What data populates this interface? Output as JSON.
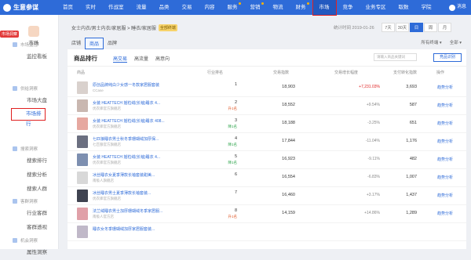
{
  "topbar": {
    "logo": "生意参谋",
    "nav": [
      "首页",
      "实时",
      "作战室",
      "流量",
      "品类",
      "交易",
      "内容",
      "服务",
      "营销",
      "物流",
      "财务",
      "市场",
      "竞争",
      "业务专区",
      "取数",
      "学院"
    ],
    "active_nav": "市场",
    "user": "消息"
  },
  "sidebar": {
    "badge": "市场洞察",
    "head_label": "市场",
    "groups": [
      {
        "title": "市场监控",
        "items": [
          "监控看板"
        ]
      },
      {
        "title": "供给洞察",
        "items": [
          "市场大盘",
          "市场排行"
        ]
      },
      {
        "title": "搜索洞察",
        "items": [
          "搜索排行",
          "搜索分析",
          "搜索人群"
        ]
      },
      {
        "title": "客群洞察",
        "items": [
          "行业客群",
          "客群透视"
        ]
      },
      {
        "title": "机会洞察",
        "items": [
          "属性洞察"
        ]
      }
    ],
    "active_item": "市场排行"
  },
  "toolbar": {
    "shop_path": "女士内衣/男士内衣/家居服 > 睡衣/家居服",
    "shop_badge": "全部终端",
    "date": "统计时间 2019-01-26",
    "ranges": [
      "7天",
      "30天",
      "日",
      "周",
      "月"
    ],
    "active_range": "日",
    "category_tabs": [
      "店铺",
      "商品",
      "品牌"
    ],
    "active_category": "商品",
    "filters": [
      "所有终端",
      "全部"
    ]
  },
  "panel": {
    "title": "商品排行",
    "sub_tabs": [
      "高交易",
      "高流量",
      "高意向"
    ],
    "active_sub_tab": "高交易",
    "search_placeholder": "请输入商品关键词",
    "compare_label": "竞品识别",
    "columns": [
      "商品",
      "行业排名",
      "交易指数",
      "交易增长幅度",
      "支付转化指数",
      "操作"
    ],
    "rows": [
      {
        "name": "原创品牌纯白少女感一冬款家居服套装",
        "shop": "CCase",
        "rank": "1",
        "change": "",
        "change_dir": "none",
        "index": "18,903",
        "growth": "+7,231.03%",
        "growth_dir": "up",
        "conversion": "3,693",
        "action": "趋势分析",
        "thumb": "#d9d1cd"
      },
      {
        "name": "女装 HEATTECH 摇粒绒(长袖)睡衣 4...",
        "shop": "优衣库官方旗舰店",
        "rank": "2",
        "change": "升1名",
        "change_dir": "up",
        "index": "18,552",
        "growth": "+9.54%",
        "growth_dir": "down",
        "conversion": "587",
        "action": "趋势分析",
        "thumb": "#c9b7b0"
      },
      {
        "name": "女装 HEATTECH 摇粒绒(长袖)睡衣 408...",
        "shop": "优衣库官方旗舰店",
        "rank": "3",
        "change": "降1名",
        "change_dir": "down",
        "index": "18,188",
        "growth": "-3.25%",
        "growth_dir": "down",
        "conversion": "651",
        "action": "趋势分析",
        "thumb": "#e6a8a0"
      },
      {
        "name": "七匹狼睡衣男士秋冬季珊瑚绒加厚保...",
        "shop": "七匹狼官方旗舰店",
        "rank": "4",
        "change": "降1名",
        "change_dir": "down",
        "index": "17,844",
        "growth": "-11.04%",
        "growth_dir": "down",
        "conversion": "1,176",
        "action": "趋势分析",
        "thumb": "#6b6f80"
      },
      {
        "name": "女装 HEATTECH 摇粒绒(长袖)睡衣 4...",
        "shop": "优衣库官方旗舰店",
        "rank": "5",
        "change": "降1名",
        "change_dir": "down",
        "index": "16,923",
        "growth": "-9.11%",
        "growth_dir": "down",
        "conversion": "482",
        "action": "趋势分析",
        "thumb": "#7d8fb0"
      },
      {
        "name": "冰丝睡衣女夏季薄款长袖套装甜美...",
        "shop": "南极人旗舰店",
        "rank": "6",
        "change": "",
        "change_dir": "none",
        "index": "16,554",
        "growth": "-6.83%",
        "growth_dir": "down",
        "conversion": "1,007",
        "action": "趋势分析",
        "thumb": "#d8d8d8"
      },
      {
        "name": "冰丝睡衣男士夏季薄款长袖套装...",
        "shop": "优衣库官方旗舰店",
        "rank": "7",
        "change": "",
        "change_dir": "none",
        "index": "16,460",
        "growth": "+3.17%",
        "growth_dir": "down",
        "conversion": "1,437",
        "action": "趋势分析",
        "thumb": "#3f4350"
      },
      {
        "name": "法兰绒睡衣男士加厚珊瑚绒冬季家居服...",
        "shop": "南极人官方店",
        "rank": "8",
        "change": "升1名",
        "change_dir": "up",
        "index": "14,159",
        "growth": "+14.86%",
        "growth_dir": "down",
        "conversion": "1,289",
        "action": "趋势分析",
        "thumb": "#e0a0a8"
      },
      {
        "name": "睡衣女冬季珊瑚绒加厚家居服套装...",
        "shop": "",
        "rank": "",
        "change": "",
        "change_dir": "none",
        "index": "",
        "growth": "",
        "growth_dir": "down",
        "conversion": "",
        "action": "",
        "thumb": "#c0b8c8"
      }
    ]
  },
  "colors": {
    "brand": "#2e6bd8",
    "highlight": "#e02020",
    "up": "#e02020",
    "down": "#2ca34a"
  }
}
